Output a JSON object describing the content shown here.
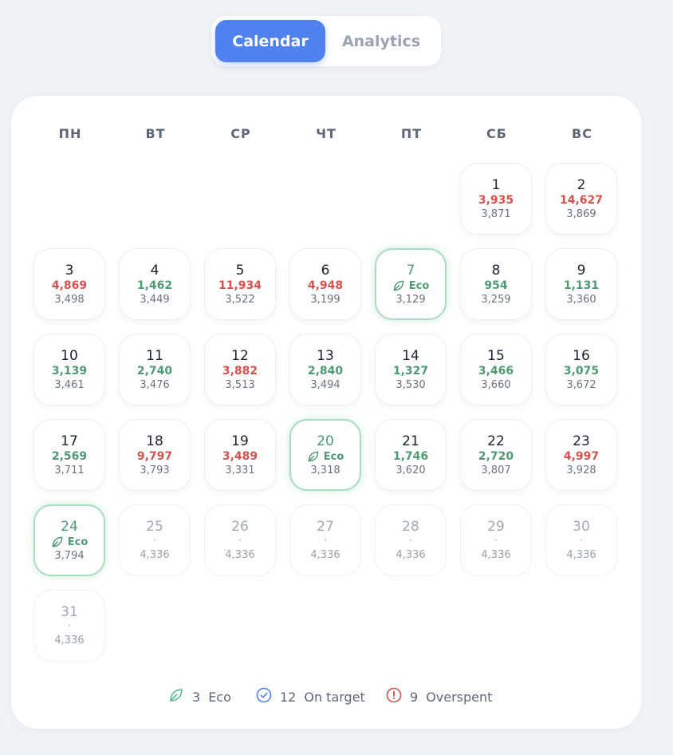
{
  "tabs": {
    "calendar": "Calendar",
    "analytics": "Analytics"
  },
  "weekdays": [
    "ПН",
    "ВТ",
    "СР",
    "ЧТ",
    "ПТ",
    "СБ",
    "ВС"
  ],
  "eco_label": "Eco",
  "days": [
    {
      "day": "1",
      "spent": "3,935",
      "status": "over",
      "budget": "3,871"
    },
    {
      "day": "2",
      "spent": "14,627",
      "status": "over",
      "budget": "3,869"
    },
    {
      "day": "3",
      "spent": "4,869",
      "status": "over",
      "budget": "3,498"
    },
    {
      "day": "4",
      "spent": "1,462",
      "status": "ok",
      "budget": "3,449"
    },
    {
      "day": "5",
      "spent": "11,934",
      "status": "over",
      "budget": "3,522"
    },
    {
      "day": "6",
      "spent": "4,948",
      "status": "over",
      "budget": "3,199"
    },
    {
      "day": "7",
      "spent": "",
      "status": "eco",
      "budget": "3,129"
    },
    {
      "day": "8",
      "spent": "954",
      "status": "ok",
      "budget": "3,259"
    },
    {
      "day": "9",
      "spent": "1,131",
      "status": "ok",
      "budget": "3,360"
    },
    {
      "day": "10",
      "spent": "3,139",
      "status": "ok",
      "budget": "3,461"
    },
    {
      "day": "11",
      "spent": "2,740",
      "status": "ok",
      "budget": "3,476"
    },
    {
      "day": "12",
      "spent": "3,882",
      "status": "over",
      "budget": "3,513"
    },
    {
      "day": "13",
      "spent": "2,840",
      "status": "ok",
      "budget": "3,494"
    },
    {
      "day": "14",
      "spent": "1,327",
      "status": "ok",
      "budget": "3,530"
    },
    {
      "day": "15",
      "spent": "3,466",
      "status": "ok",
      "budget": "3,660"
    },
    {
      "day": "16",
      "spent": "3,075",
      "status": "ok",
      "budget": "3,672"
    },
    {
      "day": "17",
      "spent": "2,569",
      "status": "ok",
      "budget": "3,711"
    },
    {
      "day": "18",
      "spent": "9,797",
      "status": "over",
      "budget": "3,793"
    },
    {
      "day": "19",
      "spent": "3,489",
      "status": "over",
      "budget": "3,331"
    },
    {
      "day": "20",
      "spent": "",
      "status": "eco",
      "budget": "3,318"
    },
    {
      "day": "21",
      "spent": "1,746",
      "status": "ok",
      "budget": "3,620"
    },
    {
      "day": "22",
      "spent": "2,720",
      "status": "ok",
      "budget": "3,807"
    },
    {
      "day": "23",
      "spent": "4,997",
      "status": "over",
      "budget": "3,928"
    },
    {
      "day": "24",
      "spent": "",
      "status": "eco",
      "budget": "3,794"
    },
    {
      "day": "25",
      "spent": "·",
      "status": "future",
      "budget": "4,336"
    },
    {
      "day": "26",
      "spent": "·",
      "status": "future",
      "budget": "4,336"
    },
    {
      "day": "27",
      "spent": "·",
      "status": "future",
      "budget": "4,336"
    },
    {
      "day": "28",
      "spent": "·",
      "status": "future",
      "budget": "4,336"
    },
    {
      "day": "29",
      "spent": "·",
      "status": "future",
      "budget": "4,336"
    },
    {
      "day": "30",
      "spent": "·",
      "status": "future",
      "budget": "4,336"
    },
    {
      "day": "31",
      "spent": "·",
      "status": "future",
      "budget": "4,336"
    }
  ],
  "legend": {
    "eco": {
      "count": "3",
      "label": "Eco",
      "icon": "leaf-icon"
    },
    "on_target": {
      "count": "12",
      "label": "On target",
      "icon": "check-circle-icon"
    },
    "overspent": {
      "count": "9",
      "label": "Overspent",
      "icon": "alert-circle-icon"
    }
  },
  "colors": {
    "accent": "#4f82ee",
    "over": "#d4524e",
    "ok": "#4f9a73",
    "on_target_icon": "#4f82ee"
  }
}
